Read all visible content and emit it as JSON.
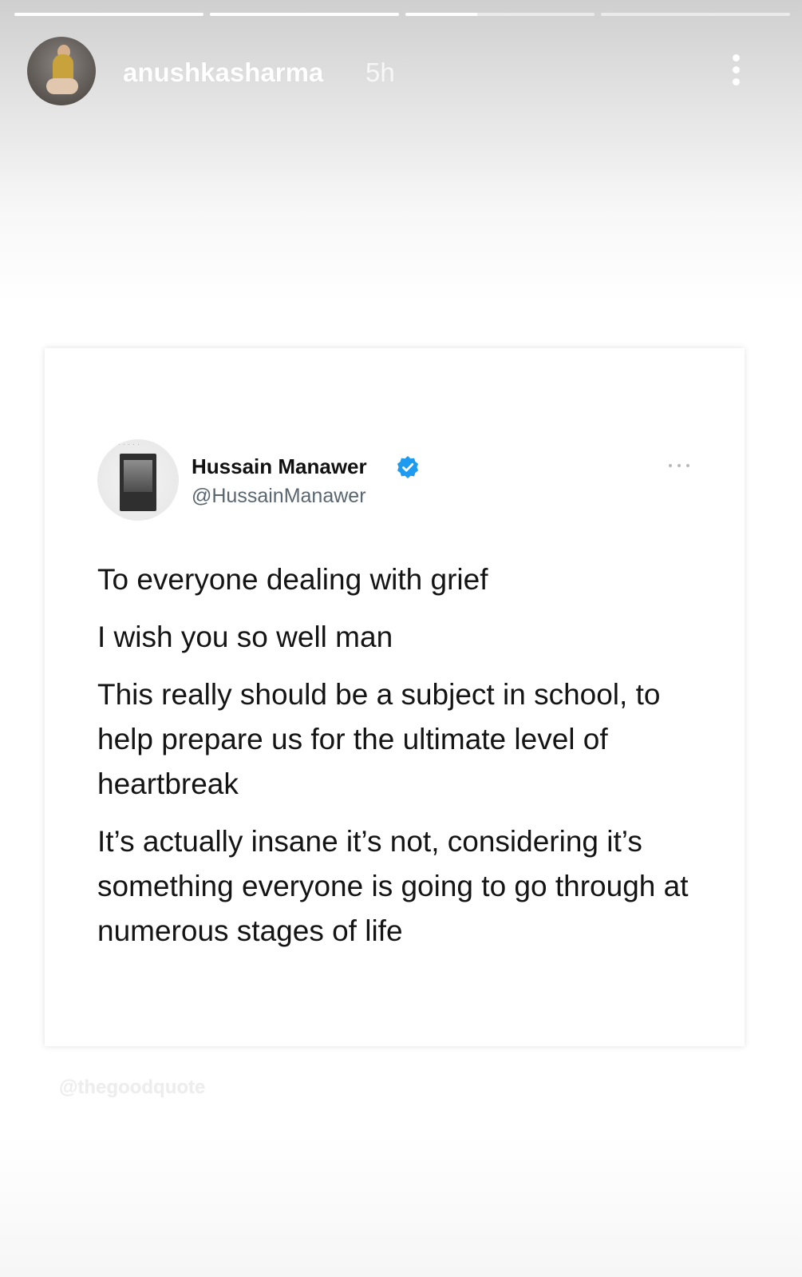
{
  "story": {
    "progress": [
      1.0,
      1.0,
      0.38,
      0.0
    ],
    "username": "anushkasharma",
    "time": "5h",
    "more_icon": "more-vertical-icon"
  },
  "tweet": {
    "name": "Hussain Manawer",
    "handle": "@HussainManawer",
    "verified_color": "#1d9bf0",
    "paragraphs": [
      "To everyone dealing with grief",
      "I wish you so well man",
      "This really should be a subject in school, to help prepare us for the ultimate level of heartbreak",
      "It’s actually insane it’s not, considering it’s something everyone is going to go through at numerous stages of life"
    ]
  },
  "watermark": "@thegoodquote"
}
